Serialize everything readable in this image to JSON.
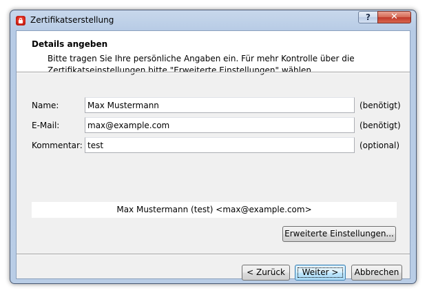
{
  "window": {
    "title": "Zertifikatserstellung",
    "help_label": "?",
    "close_label": "✕"
  },
  "header": {
    "title": "Details angeben",
    "description": "Bitte tragen Sie Ihre persönliche Angaben ein. Für mehr Kontrolle über die Zertifikatseinstellungen bitte \"Erweiterte Einstellungen\" wählen."
  },
  "form": {
    "fields": [
      {
        "label": "Name:",
        "value": "Max Mustermann",
        "hint": "(benötigt)"
      },
      {
        "label": "E-Mail:",
        "value": "max@example.com",
        "hint": "(benötigt)"
      },
      {
        "label": "Kommentar:",
        "value": "test",
        "hint": "(optional)"
      }
    ]
  },
  "preview": {
    "text": "Max Mustermann (test) <max@example.com>"
  },
  "buttons": {
    "advanced": "Erweiterte Einstellungen...",
    "back": "< Zurück",
    "next": "Weiter >",
    "cancel": "Abbrechen"
  },
  "icons": {
    "app": "certificate-app-icon",
    "help": "help-icon",
    "close": "close-icon"
  },
  "colors": {
    "close_button": "#c0392b",
    "focus_button_border": "#3c7fb1",
    "window_frame": "#b9cde6"
  }
}
